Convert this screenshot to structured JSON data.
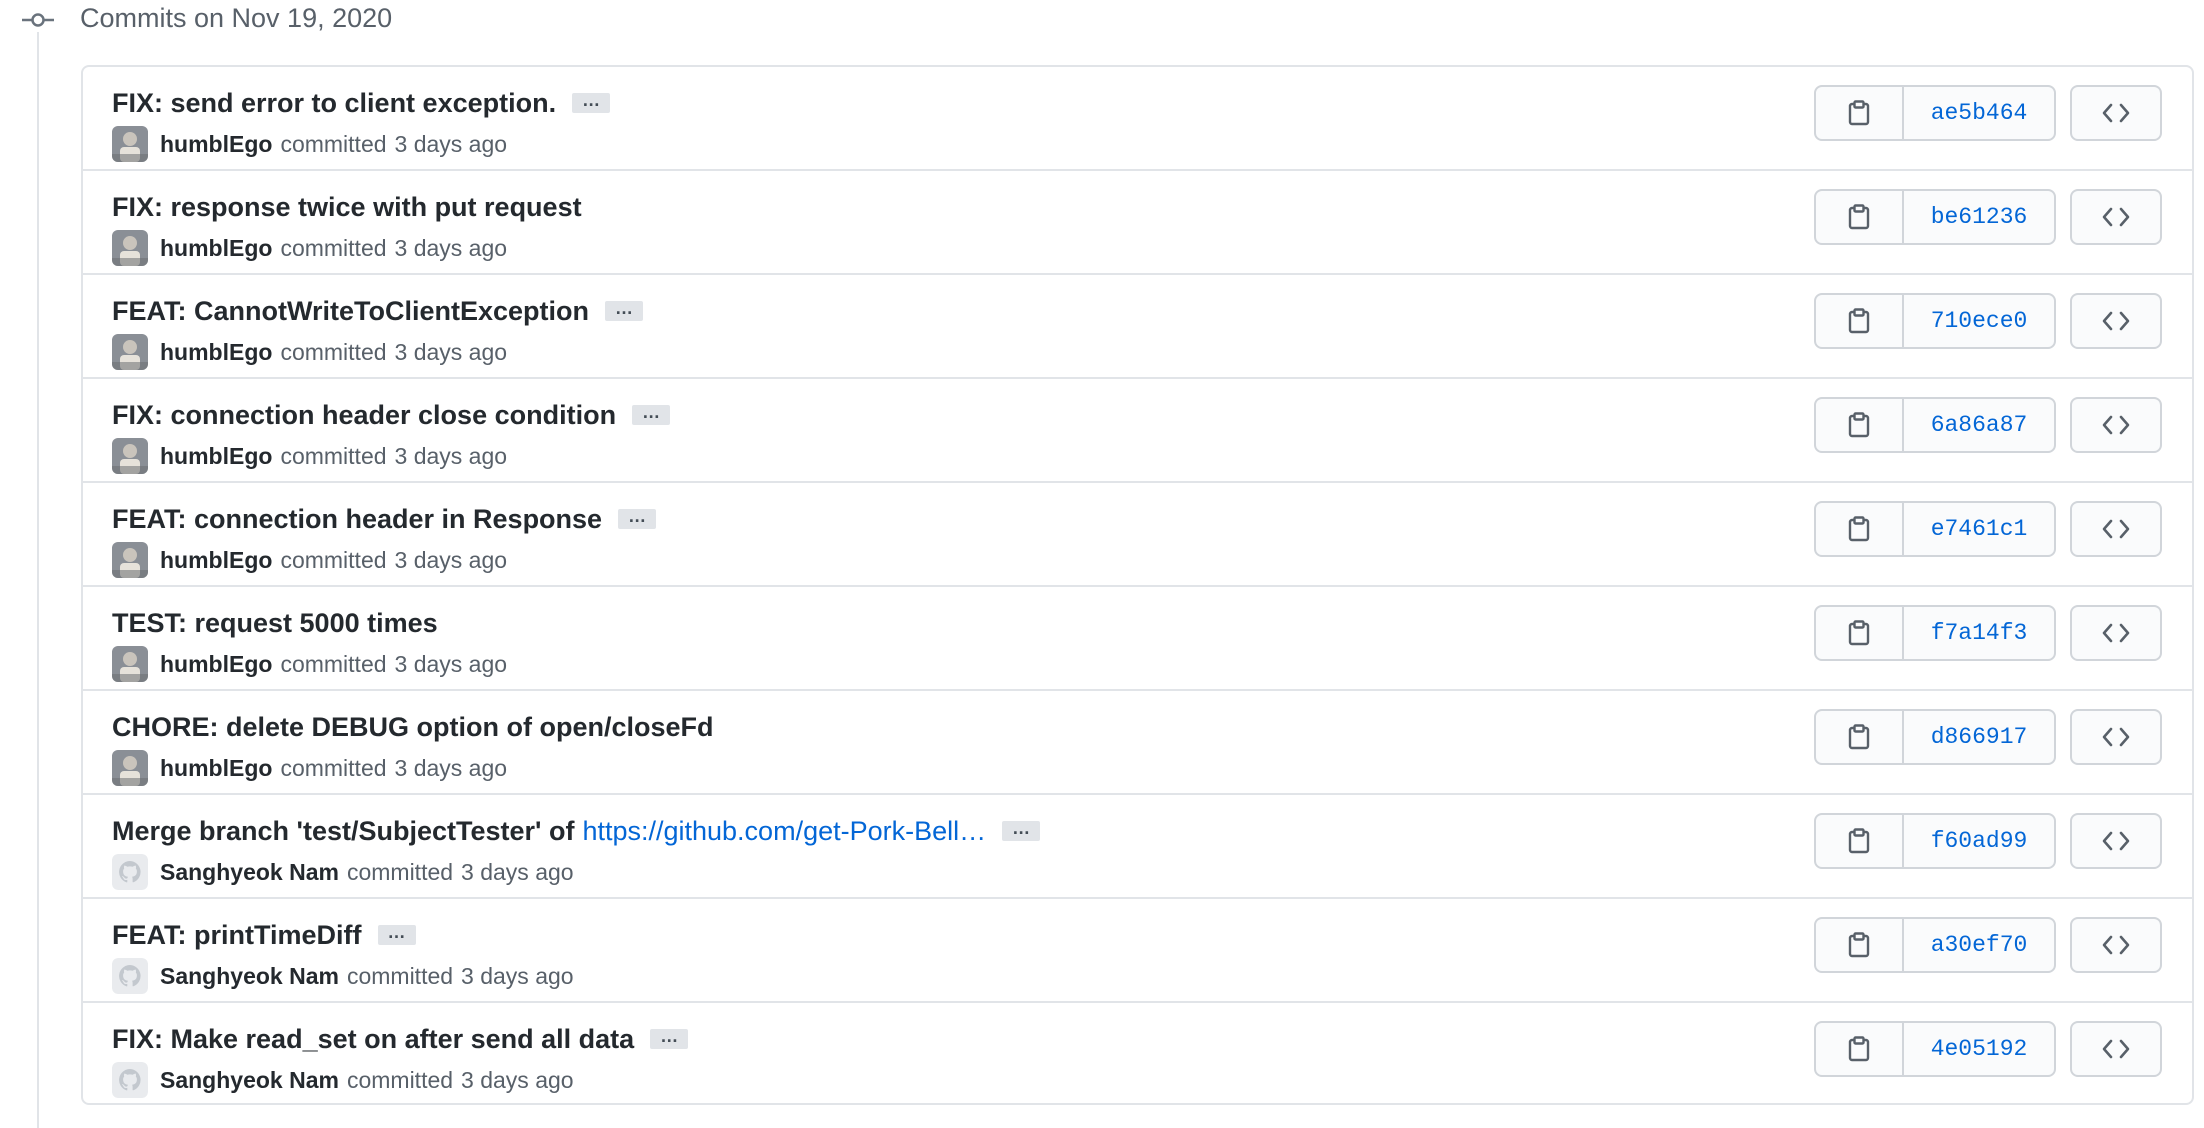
{
  "timeline": {
    "date_title": "Commits on Nov 19, 2020"
  },
  "commits": [
    {
      "message": "FIX: send error to client exception.",
      "link_text": "",
      "has_more": true,
      "author": "humblEgo",
      "verb": "committed",
      "time": "3 days ago",
      "sha": "ae5b464",
      "avatar": "photo"
    },
    {
      "message": "FIX: response twice with put request",
      "link_text": "",
      "has_more": false,
      "author": "humblEgo",
      "verb": "committed",
      "time": "3 days ago",
      "sha": "be61236",
      "avatar": "photo"
    },
    {
      "message": "FEAT: CannotWriteToClientException",
      "link_text": "",
      "has_more": true,
      "author": "humblEgo",
      "verb": "committed",
      "time": "3 days ago",
      "sha": "710ece0",
      "avatar": "photo"
    },
    {
      "message": "FIX: connection header close condition",
      "link_text": "",
      "has_more": true,
      "author": "humblEgo",
      "verb": "committed",
      "time": "3 days ago",
      "sha": "6a86a87",
      "avatar": "photo"
    },
    {
      "message": "FEAT: connection header in Response",
      "link_text": "",
      "has_more": true,
      "author": "humblEgo",
      "verb": "committed",
      "time": "3 days ago",
      "sha": "e7461c1",
      "avatar": "photo"
    },
    {
      "message": "TEST: request 5000 times",
      "link_text": "",
      "has_more": false,
      "author": "humblEgo",
      "verb": "committed",
      "time": "3 days ago",
      "sha": "f7a14f3",
      "avatar": "photo"
    },
    {
      "message": "CHORE: delete DEBUG option of open/closeFd",
      "link_text": "",
      "has_more": false,
      "author": "humblEgo",
      "verb": "committed",
      "time": "3 days ago",
      "sha": "d866917",
      "avatar": "photo"
    },
    {
      "message": "Merge branch 'test/SubjectTester' of",
      "link_text": "https://github.com/get-Pork-Bell…",
      "has_more": true,
      "author": "Sanghyeok Nam",
      "verb": "committed",
      "time": "3 days ago",
      "sha": "f60ad99",
      "avatar": "octocat"
    },
    {
      "message": "FEAT: printTimeDiff",
      "link_text": "",
      "has_more": true,
      "author": "Sanghyeok Nam",
      "verb": "committed",
      "time": "3 days ago",
      "sha": "a30ef70",
      "avatar": "octocat"
    },
    {
      "message": "FIX: Make read_set on after send all data",
      "link_text": "",
      "has_more": true,
      "author": "Sanghyeok Nam",
      "verb": "committed",
      "time": "3 days ago",
      "sha": "4e05192",
      "avatar": "octocat"
    }
  ],
  "ellipsis_label": "…",
  "colors": {
    "link": "#0366d6",
    "border": "#e1e4e8",
    "muted": "#586069"
  }
}
